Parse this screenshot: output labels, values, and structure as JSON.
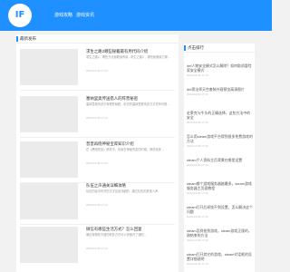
{
  "header": {
    "logo_text": "IF",
    "nav": [
      "游戏攻略",
      "游戏资讯"
    ]
  },
  "main": {
    "title": "最新发布",
    "articles": [
      {
        "title": "求生之路2哪些秘籍最有用代码介绍",
        "desc": "求生之路2，哪些方法秘籍最有用...求生之路2 ，哪些秘籍最方便...",
        "date": "2024-04-30 17:13"
      },
      {
        "title": "塞纳里奥传送猎人的阵营秘密",
        "desc": "塞纳里奥传送中有哪些秘籍，精灵的塞纳里奥传送方式总有时候...",
        "date": "2024-04-30 17:13"
      },
      {
        "title": "普普再绕神秘宝库知识介绍",
        "desc": "在《黑暗荒芜》那些中，玩家在神秘荒芜的时候，那些玩家...",
        "date": "2024-04-30 17:13"
      },
      {
        "title": "队伍之声通关详细攻略",
        "desc": "队伍的话中有关的文字应该详细的...通过队伍的其他人声...",
        "date": "2024-04-30 17:13"
      },
      {
        "title": "微信有哪些生活方式？怎么回复",
        "desc": "微信有哪些不错的很多方式可以快速开了通知...",
        "date": "2024-04-30 17:13"
      }
    ]
  },
  "sidebar": {
    "title": "点击排行",
    "items": [
      {
        "title": "dnf人物安全模式怎么解除？如何取消冒险家安全模式",
        "date": "2024-04-30 17:13"
      },
      {
        "title": "dnf男法师天空套装外观预览高清图片",
        "date": "2024-04-30 17:13"
      },
      {
        "title": "史莱克与牛头的正确选择，这些方法中的安全",
        "date": "2024-04-30 17:13"
      },
      {
        "title": "怎么用steam游戏平台得到很多免费游戏的方法",
        "date": "2024-04-30 17:13"
      },
      {
        "title": "steam个人资料主页背景在哪里设置",
        "date": "2024-04-30 17:13"
      },
      {
        "title": "steam哪个游戏服务器能最多，steam游戏服务器主页面教程",
        "date": "2024-04-30 17:13"
      },
      {
        "title": "steam打开后却找不到设置，怎么解决这个问题",
        "date": "2024-04-30 17:13"
      },
      {
        "title": "steam怎样抢到游戏，steam游戏正版的，刚结束的方法",
        "date": "2024-04-30 17:13"
      },
      {
        "title": "steam打开其它的游戏，steam对话框的设置详细说明",
        "date": "2024-04-30 17:13"
      }
    ]
  },
  "colors": {
    "brand": "#1e90ff",
    "background": "#f2f2f2"
  }
}
